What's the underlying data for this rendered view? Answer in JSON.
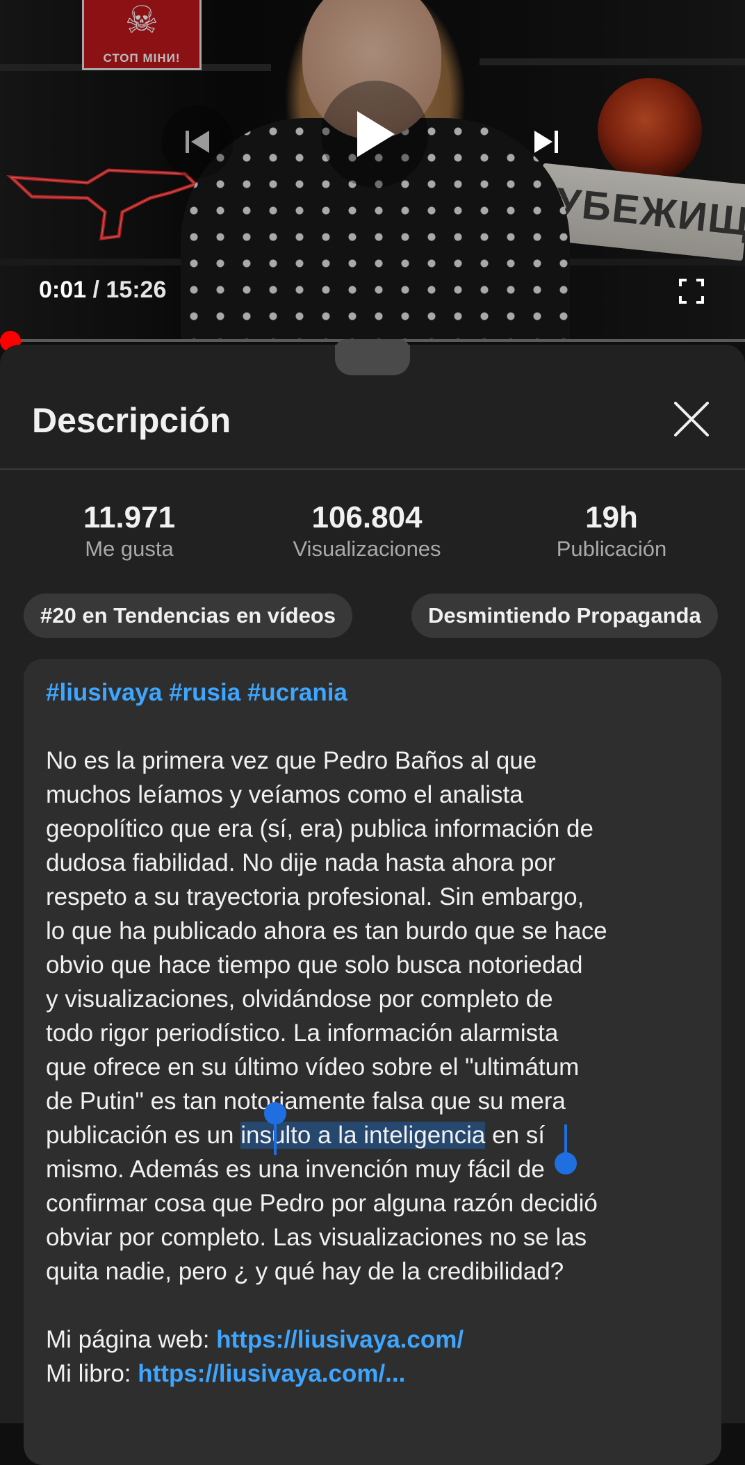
{
  "player": {
    "current_time": "0:01",
    "separator": " / ",
    "duration": "15:26",
    "progress_fraction": 0.001,
    "scene_sign_text": "СТОП МІНИ!",
    "scene_plate_text": "УБЕЖИЩЕ",
    "icons": [
      "previous-icon",
      "play-icon",
      "next-icon",
      "fullscreen-icon"
    ]
  },
  "sheet": {
    "title": "Descripción",
    "close_icon": "close-icon",
    "stats": [
      {
        "value": "11.971",
        "label": "Me gusta"
      },
      {
        "value": "106.804",
        "label": "Visualizaciones"
      },
      {
        "value": "19h",
        "label": "Publicación"
      }
    ],
    "chips": [
      "#20 en Tendencias en vídeos",
      "Desmintiendo Propaganda"
    ],
    "description": {
      "hashtags": [
        "#liusivaya",
        "#rusia",
        "#ucrania"
      ],
      "lines": [
        "No es la primera vez que Pedro Baños al que",
        "muchos leíamos y veíamos como el analista",
        "geopolítico que era (sí, era) publica información de",
        "dudosa fiabilidad. No dije nada hasta ahora por",
        "respeto a su trayectoria profesional. Sin embargo,",
        "lo que ha publicado ahora es tan burdo que se hace",
        "obvio que hace tiempo que solo busca notoriedad",
        "y visualizaciones, olvidándose por completo de",
        "todo rigor periodístico. La información alarmista",
        "que ofrece en su último vídeo sobre el \"ultimátum",
        "de Putin\" es tan notoriamente falsa que su mera"
      ],
      "line_selected_before": "publicación es un ",
      "selected_text": "insulto a la inteligencia",
      "line_selected_after": " en sí",
      "lines_after": [
        "mismo. Además es una invención muy fácil de",
        "confirmar cosa que Pedro por alguna razón decidió",
        "obviar por completo. Las visualizaciones no se las",
        "quita nadie, pero ¿ y qué hay de la credibilidad?"
      ],
      "web_label": "Mi página web: ",
      "web_link": "https://liusivaya.com/",
      "book_label": "Mi libro: ",
      "book_link": "https://liusivaya.com/..."
    }
  },
  "colors": {
    "accent_link": "#3ea6ff",
    "progress_red": "#ff0000",
    "selection": "#26486f",
    "selection_handle": "#1f6fe0"
  }
}
